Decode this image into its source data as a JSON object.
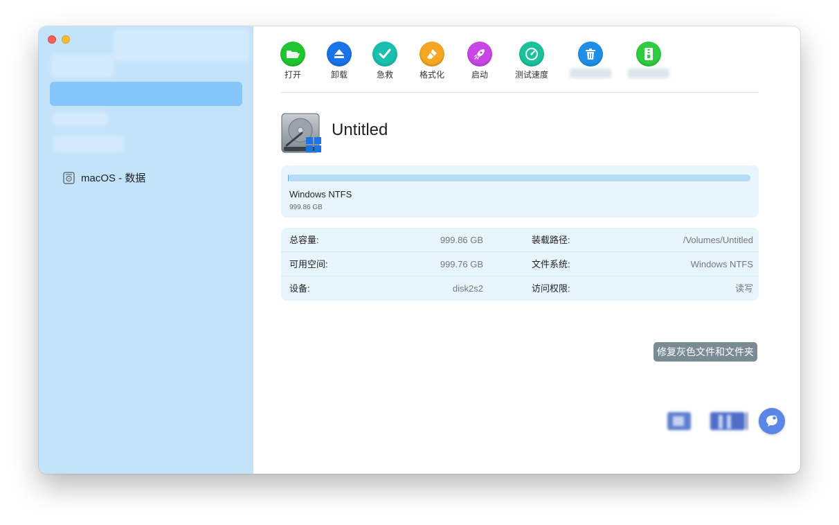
{
  "toolbar": {
    "items": [
      {
        "id": "open",
        "label": "打开",
        "icon": "folder-open-icon",
        "color": "#1fc62f"
      },
      {
        "id": "unmount",
        "label": "卸载",
        "icon": "eject-icon",
        "color": "#1a73e8"
      },
      {
        "id": "rescue",
        "label": "急救",
        "icon": "checkmark-icon",
        "color": "#18c0ad"
      },
      {
        "id": "format",
        "label": "格式化",
        "icon": "eraser-icon",
        "color": "#f5a623"
      },
      {
        "id": "boot",
        "label": "启动",
        "icon": "rocket-icon",
        "color": "#c845e6"
      },
      {
        "id": "speed",
        "label": "测试速度",
        "icon": "speedometer-icon",
        "color": "#19c29a"
      },
      {
        "id": "trash",
        "label": "",
        "icon": "trash-icon",
        "color": "#1e8fe8"
      },
      {
        "id": "zip",
        "label": "",
        "icon": "zip-icon",
        "color": "#2ecc40"
      }
    ]
  },
  "sidebar": {
    "items": [
      {
        "label": "macOS - 数据",
        "icon": "internal-disk-icon"
      }
    ]
  },
  "disk": {
    "name": "Untitled",
    "icon": "hard-drive-windows-icon",
    "volume": {
      "format": "Windows NTFS",
      "size": "999.86 GB",
      "used_fraction": 0.002
    }
  },
  "info": {
    "rows": [
      {
        "k1": "总容量:",
        "v1": "999.86 GB",
        "k2": "装载路径:",
        "v2": "/Volumes/Untitled"
      },
      {
        "k1": "可用空间:",
        "v1": "999.76 GB",
        "k2": "文件系统:",
        "v2": "Windows NTFS"
      },
      {
        "k1": "设备:",
        "v1": "disk2s2",
        "k2": "访问权限:",
        "v2": "读写"
      }
    ]
  },
  "actions": {
    "repair_label": "修复灰色文件和文件夹"
  },
  "colors": {
    "sidebar_bg": "#c3e3fb",
    "sidebar_selected": "#86c7fb",
    "card_bg": "#e7f5fd",
    "repair_button_bg": "#7a8b94",
    "chat_button_bg": "#5a86e8"
  }
}
